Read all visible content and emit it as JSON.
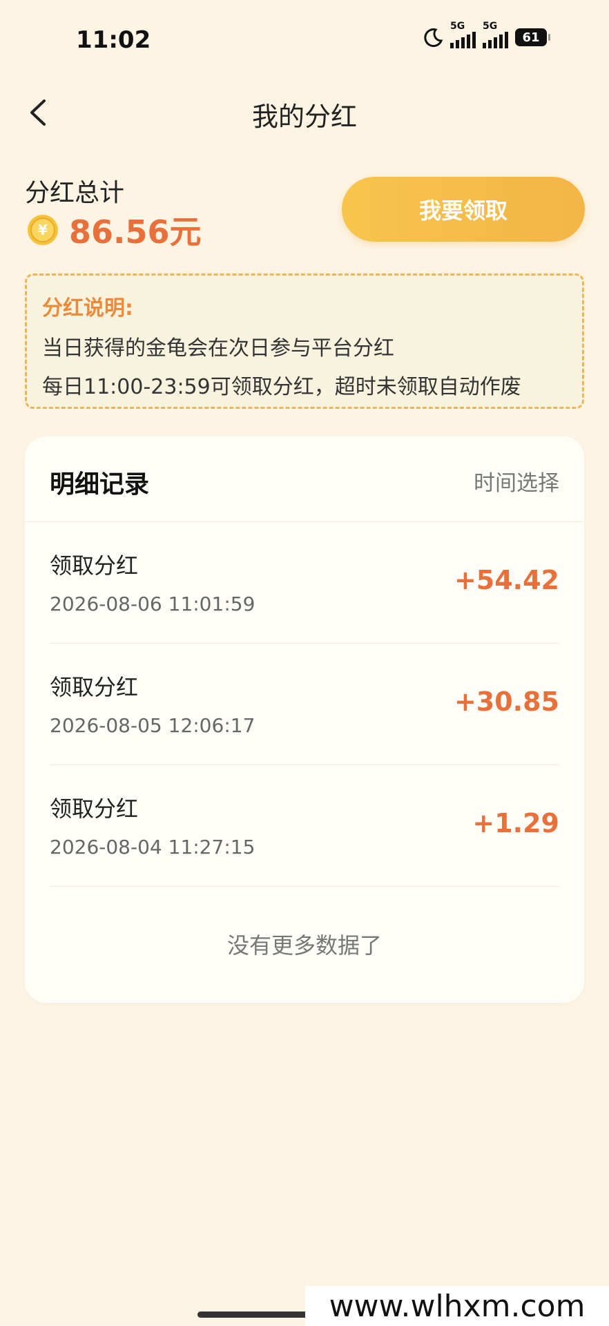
{
  "status_bar": {
    "time": "11:02",
    "signal_1": "5G",
    "signal_2": "5G",
    "battery": "61",
    "icons": [
      "moon-icon",
      "signal-icon",
      "signal-icon",
      "battery-icon"
    ]
  },
  "nav": {
    "title": "我的分红",
    "back_icon": "chevron-left-icon"
  },
  "summary": {
    "label": "分红总计",
    "amount": "86.56元",
    "coin_icon": "yuan-coin-icon",
    "claim_button": "我要领取"
  },
  "notice": {
    "title": "分红说明:",
    "lines": [
      "当日获得的金龟会在次日参与平台分红",
      "每日11:00-23:59可领取分红，超时未领取自动作废"
    ]
  },
  "records": {
    "title": "明细记录",
    "time_select": "时间选择",
    "items": [
      {
        "title": "领取分红",
        "time": "2026-08-06 11:01:59",
        "amount": "+54.42"
      },
      {
        "title": "领取分红",
        "time": "2026-08-05 12:06:17",
        "amount": "+30.85"
      },
      {
        "title": "领取分红",
        "time": "2026-08-04 11:27:15",
        "amount": "+1.29"
      }
    ],
    "no_more": "没有更多数据了"
  },
  "watermark": "www.wlhxm.com",
  "colors": {
    "background": "#fdf4e4",
    "accent": "#e8703a",
    "button": "#f5bd4a",
    "notice_border": "#efb453"
  }
}
